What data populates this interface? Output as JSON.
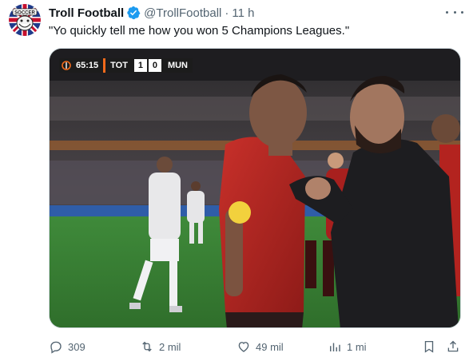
{
  "tweet": {
    "display_name": "Troll Football",
    "handle": "@TrollFootball",
    "separator": "·",
    "time": "11 h",
    "text": "\"Yo quickly tell me how you won 5 Champions Leagues.\"",
    "avatar_text": "SOCCER",
    "verified_color": "#1d9bf0"
  },
  "scorebug": {
    "clock": "65:15",
    "home_team": "TOT",
    "home_score": "1",
    "away_score": "0",
    "away_team": "MUN"
  },
  "actions": {
    "replies": "309",
    "reposts": "2 mil",
    "likes": "49 mil",
    "views": "1 mi"
  },
  "icons": [
    "more-icon",
    "reply-icon",
    "repost-icon",
    "like-icon",
    "views-icon",
    "bookmark-icon",
    "share-icon",
    "verified-icon"
  ],
  "colors": {
    "text": "#0f1419",
    "secondary": "#536471",
    "accent": "#1d9bf0"
  }
}
